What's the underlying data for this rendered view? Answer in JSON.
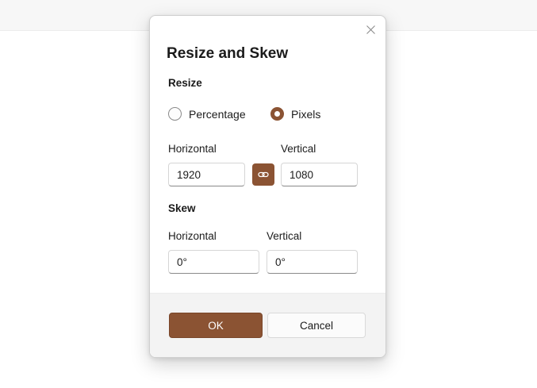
{
  "dialog": {
    "title": "Resize and Skew",
    "close_icon": "close-icon"
  },
  "resize": {
    "section_label": "Resize",
    "options": [
      {
        "label": "Percentage",
        "checked": false
      },
      {
        "label": "Pixels",
        "checked": true
      }
    ],
    "horizontal_label": "Horizontal",
    "horizontal_value": "1920",
    "vertical_label": "Vertical",
    "vertical_value": "1080",
    "link_icon": "link-icon"
  },
  "skew": {
    "section_label": "Skew",
    "horizontal_label": "Horizontal",
    "horizontal_value": "0°",
    "vertical_label": "Vertical",
    "vertical_value": "0°"
  },
  "footer": {
    "ok_label": "OK",
    "cancel_label": "Cancel"
  },
  "colors": {
    "accent": "#8b5333",
    "footer_bg": "#f3f3f3"
  }
}
